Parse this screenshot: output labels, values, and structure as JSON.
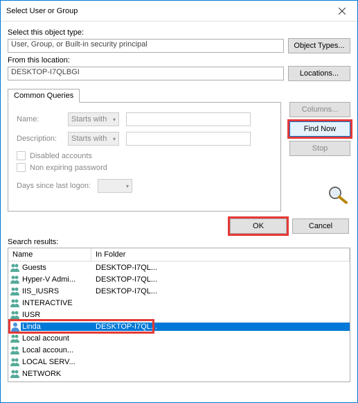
{
  "title": "Select User or Group",
  "objectType": {
    "label": "Select this object type:",
    "value": "User, Group, or Built-in security principal",
    "btn": "Object Types..."
  },
  "location": {
    "label": "From this location:",
    "value": "DESKTOP-I7QLBGI",
    "btn": "Locations..."
  },
  "tab": "Common Queries",
  "query": {
    "nameLabel": "Name:",
    "nameMode": "Starts with",
    "descLabel": "Description:",
    "descMode": "Starts with",
    "disabled": "Disabled accounts",
    "nonexp": "Non expiring password",
    "daysLabel": "Days since last logon:"
  },
  "side": {
    "columns": "Columns...",
    "find": "Find Now",
    "stop": "Stop"
  },
  "footer": {
    "ok": "OK",
    "cancel": "Cancel"
  },
  "searchLabel": "Search results:",
  "cols": {
    "name": "Name",
    "folder": "In Folder"
  },
  "results": [
    {
      "name": "Guests",
      "folder": "DESKTOP-I7QL...",
      "t": "g"
    },
    {
      "name": "Hyper-V Admi...",
      "folder": "DESKTOP-I7QL...",
      "t": "g"
    },
    {
      "name": "IIS_IUSRS",
      "folder": "DESKTOP-I7QL...",
      "t": "g"
    },
    {
      "name": "INTERACTIVE",
      "folder": "",
      "t": "g"
    },
    {
      "name": "IUSR",
      "folder": "",
      "t": "g"
    },
    {
      "name": "Linda",
      "folder": "DESKTOP-I7QL...",
      "t": "u",
      "selected": true
    },
    {
      "name": "Local account",
      "folder": "",
      "t": "g"
    },
    {
      "name": "Local accoun...",
      "folder": "",
      "t": "g"
    },
    {
      "name": "LOCAL SERV...",
      "folder": "",
      "t": "g"
    },
    {
      "name": "NETWORK",
      "folder": "",
      "t": "g"
    }
  ]
}
